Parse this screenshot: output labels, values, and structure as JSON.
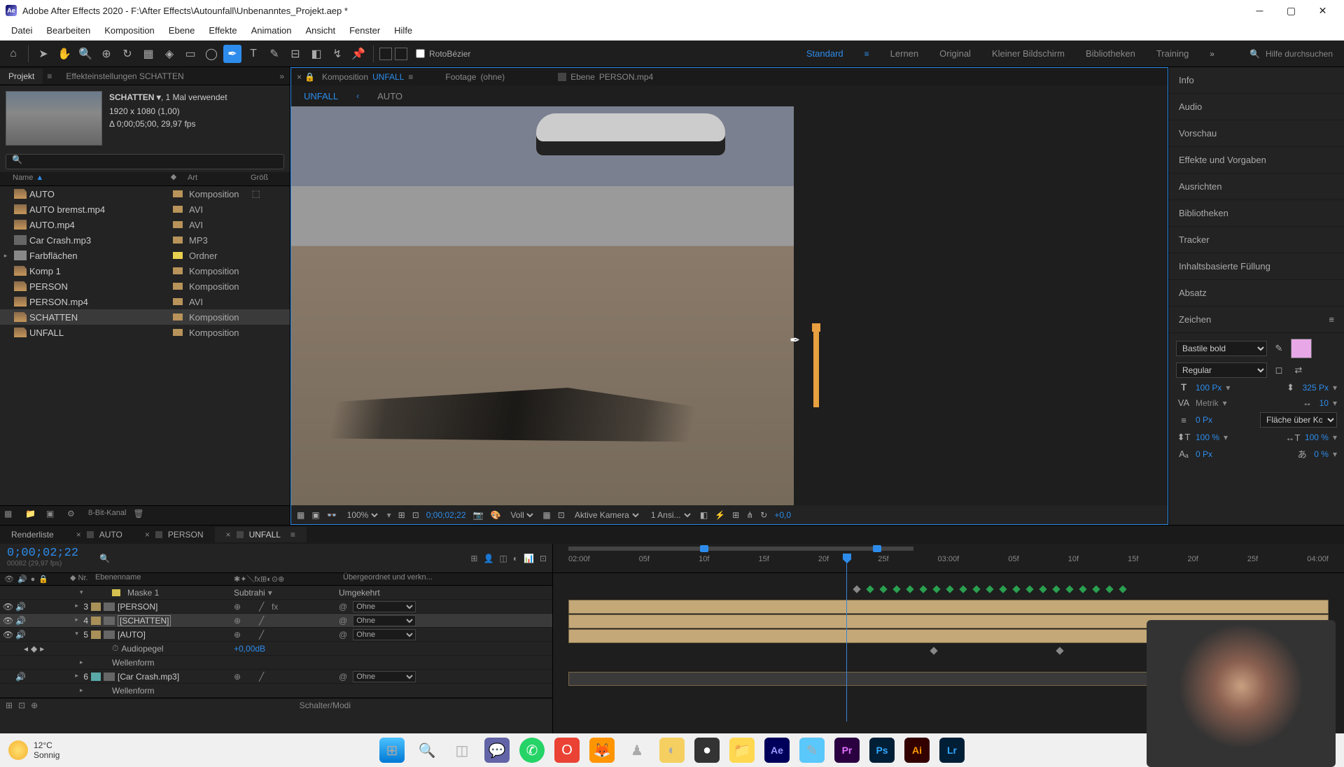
{
  "titlebar": {
    "app": "Adobe After Effects 2020",
    "path": "F:\\After Effects\\Autounfall\\Unbenanntes_Projekt.aep *"
  },
  "menus": [
    "Datei",
    "Bearbeiten",
    "Komposition",
    "Ebene",
    "Effekte",
    "Animation",
    "Ansicht",
    "Fenster",
    "Hilfe"
  ],
  "toolbar": {
    "rotobezier": "RotoBézier",
    "workspaces": [
      "Standard",
      "Lernen",
      "Original",
      "Kleiner Bildschirm",
      "Bibliotheken",
      "Training"
    ],
    "active_workspace": "Standard",
    "search_placeholder": "Hilfe durchsuchen"
  },
  "project": {
    "tab": "Projekt",
    "effect_settings_prefix": "Effekteinstellungen",
    "effect_settings_name": "SCHATTEN",
    "selected_name": "SCHATTEN ▾",
    "usage": ", 1 Mal verwendet",
    "dims": "1920 x 1080 (1,00)",
    "dur": "Δ 0;00;05;00, 29,97 fps",
    "cols": {
      "name": "Name",
      "type": "Art",
      "size": "Größ"
    },
    "items": [
      {
        "name": "AUTO",
        "type": "Komposition",
        "icon": "comp",
        "swatch": "#b8935a",
        "used": true
      },
      {
        "name": "AUTO bremst.mp4",
        "type": "AVI",
        "icon": "vid",
        "swatch": "#b8935a"
      },
      {
        "name": "AUTO.mp4",
        "type": "AVI",
        "icon": "vid",
        "swatch": "#b8935a"
      },
      {
        "name": "Car Crash.mp3",
        "type": "MP3",
        "icon": "audio",
        "swatch": "#b8935a"
      },
      {
        "name": "Farbflächen",
        "type": "Ordner",
        "icon": "folder",
        "swatch": "#e8d050",
        "expandable": true
      },
      {
        "name": "Komp 1",
        "type": "Komposition",
        "icon": "comp",
        "swatch": "#b8935a"
      },
      {
        "name": "PERSON",
        "type": "Komposition",
        "icon": "comp",
        "swatch": "#b8935a"
      },
      {
        "name": "PERSON.mp4",
        "type": "AVI",
        "icon": "vid",
        "swatch": "#b8935a"
      },
      {
        "name": "SCHATTEN",
        "type": "Komposition",
        "icon": "comp",
        "swatch": "#b8935a",
        "selected": true
      },
      {
        "name": "UNFALL",
        "type": "Komposition",
        "icon": "comp",
        "swatch": "#b8935a"
      }
    ],
    "bitdepth": "8-Bit-Kanal"
  },
  "composition": {
    "tabs": [
      {
        "label": "Komposition",
        "name": "UNFALL",
        "active": true,
        "closable": true
      },
      {
        "label": "Footage",
        "name": "(ohne)"
      },
      {
        "label": "Ebene",
        "name": "PERSON.mp4"
      }
    ],
    "subtabs": [
      {
        "name": "UNFALL",
        "active": true
      },
      {
        "name": "AUTO"
      }
    ],
    "controls": {
      "zoom": "100%",
      "timecode": "0;00;02;22",
      "channel": "Voll",
      "camera": "Aktive Kamera",
      "views": "1 Ansi...",
      "exposure": "+0,0"
    }
  },
  "right_panels": [
    "Info",
    "Audio",
    "Vorschau",
    "Effekte und Vorgaben",
    "Ausrichten",
    "Bibliotheken",
    "Tracker",
    "Inhaltsbasierte Füllung",
    "Absatz",
    "Zeichen"
  ],
  "character": {
    "font": "Bastile bold",
    "style": "Regular",
    "size": "100 Px",
    "leading": "325 Px",
    "kerning": "Metrik",
    "tracking": "10",
    "stroke": "0 Px",
    "stroke_opt": "Fläche über Kon...",
    "hscale": "100 %",
    "vscale": "100 %",
    "baseline": "0 Px",
    "tsume": "0 %",
    "color": "#e8a8e8"
  },
  "timeline": {
    "tabs": [
      "Renderliste",
      "AUTO",
      "PERSON",
      "UNFALL"
    ],
    "active_tab": "UNFALL",
    "timecode": "0;00;02;22",
    "frames": "00082 (29,97 fps)",
    "cols": {
      "num": "Nr.",
      "name": "Ebenenname",
      "parent": "Übergeordnet und verkn..."
    },
    "mask_label": "Maske 1",
    "mask_mode": "Subtrahi",
    "mask_invert": "Umgekehrt",
    "layers": [
      {
        "num": "3",
        "name": "[PERSON]",
        "swatch": "#a89058",
        "parent": "Ohne",
        "fx": true
      },
      {
        "num": "4",
        "name": "[SCHATTEN]",
        "swatch": "#a89058",
        "parent": "Ohne",
        "selected": true,
        "boxed": true
      },
      {
        "num": "5",
        "name": "[AUTO]",
        "swatch": "#a89058",
        "parent": "Ohne",
        "expanded": true
      },
      {
        "num": "6",
        "name": "[Car Crash.mp3]",
        "swatch": "#5aa8a8",
        "parent": "Ohne"
      }
    ],
    "audiopegel": "Audiopegel",
    "audiopegel_val": "+0,00dB",
    "wellenform": "Wellenform",
    "ruler": [
      "02:00f",
      "05f",
      "10f",
      "15f",
      "20f",
      "25f",
      "03:00f",
      "05f",
      "10f",
      "15f",
      "20f",
      "25f",
      "04:00f"
    ],
    "footer": "Schalter/Modi"
  },
  "taskbar": {
    "temp": "12°C",
    "cond": "Sonnig"
  }
}
